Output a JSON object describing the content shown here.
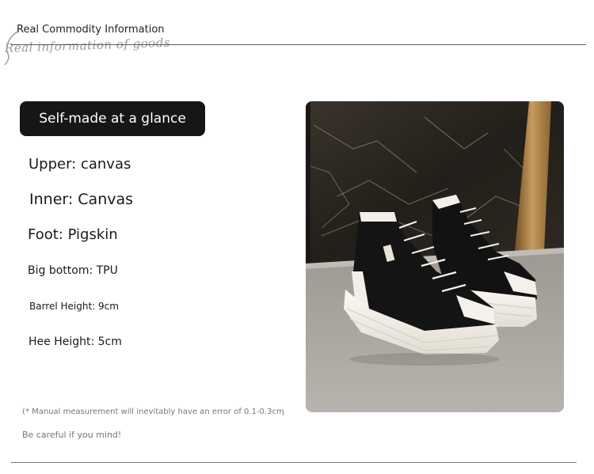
{
  "header": {
    "title": "Real Commodity Information",
    "script_subtitle": "Real information of goods"
  },
  "badge": {
    "label": "Self-made at a glance"
  },
  "specs": [
    "Upper: canvas",
    "Inner: Canvas",
    "Foot: Pigskin",
    "Big bottom: TPU",
    "Barrel Height: 9cm",
    "Hee Height: 5cm"
  ],
  "notes": {
    "measurement": "(* Manual measurement will inevitably have an error of 0.1-0.3cm",
    "comma": ",",
    "careful": "Be careful if you mind!"
  },
  "product_image": {
    "description_icon": "sneaker-photo",
    "colors": {
      "upper": "#141414",
      "sole": "#f4f1ea",
      "marble": "#2e2a25",
      "floor": "#a8a29c"
    }
  }
}
